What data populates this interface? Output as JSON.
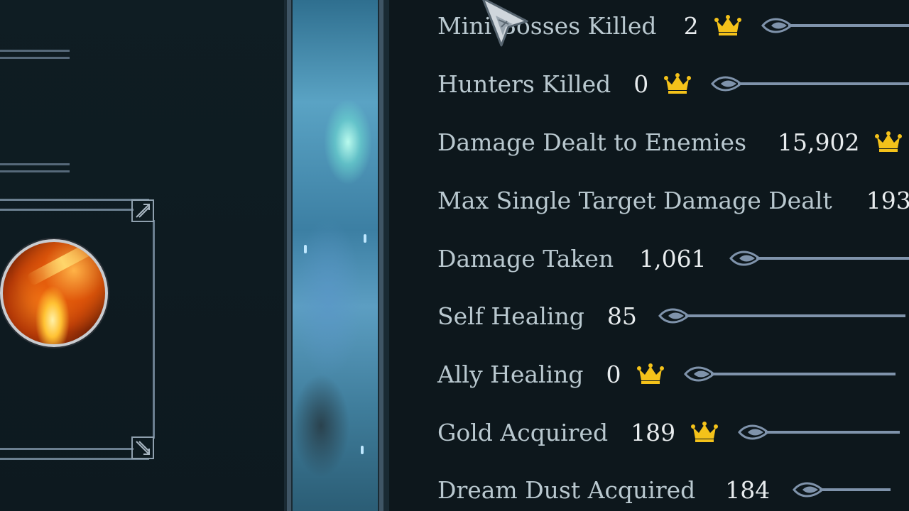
{
  "stats": [
    {
      "label": "Mini Bosses Killed",
      "value": "2",
      "crown": true
    },
    {
      "label": "Hunters Killed",
      "value": "0",
      "crown": true
    },
    {
      "label": "Damage Dealt to Enemies",
      "value": "15,902",
      "crown": true
    },
    {
      "label": "Max Single Target Damage Dealt",
      "value": "193",
      "crown": false
    },
    {
      "label": "Damage Taken",
      "value": "1,061",
      "crown": false
    },
    {
      "label": "Self Healing",
      "value": "85",
      "crown": false
    },
    {
      "label": "Ally Healing",
      "value": "0",
      "crown": true
    },
    {
      "label": "Gold Acquired",
      "value": "189",
      "crown": true
    },
    {
      "label": "Dream Dust Acquired",
      "value": "184",
      "crown": false
    }
  ],
  "icons": {
    "crown": "crown-icon",
    "arrow": "arrow-divider-icon",
    "cursor": "pointer-cursor-icon",
    "ability": "fire-ability-icon"
  },
  "colors": {
    "crown": "#f4c21a",
    "label": "#b9c8cf",
    "value": "#e8ecee",
    "arrow": "#7f93ab"
  }
}
